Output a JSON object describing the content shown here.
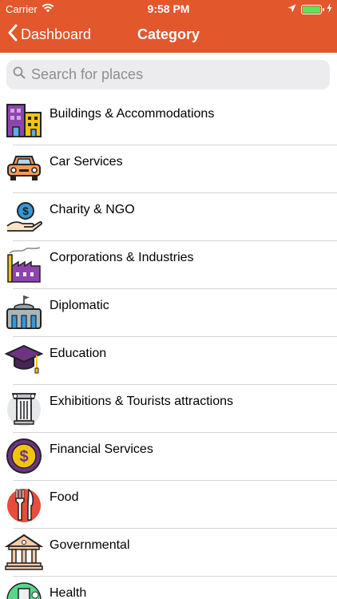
{
  "status_bar": {
    "carrier": "Carrier",
    "time": "9:58 PM",
    "battery_color": "#5ce35c"
  },
  "nav": {
    "back_label": "Dashboard",
    "title": "Category"
  },
  "search": {
    "placeholder": "Search for places",
    "value": ""
  },
  "colors": {
    "header": "#e2572c",
    "search_bg": "#ececee",
    "separator": "#d4d4d8"
  },
  "categories": [
    {
      "label": "Buildings & Accommodations",
      "icon": "buildings-icon"
    },
    {
      "label": "Car Services",
      "icon": "car-icon"
    },
    {
      "label": "Charity & NGO",
      "icon": "charity-hand-icon"
    },
    {
      "label": "Corporations & Industries",
      "icon": "factory-icon"
    },
    {
      "label": "Diplomatic",
      "icon": "embassy-icon"
    },
    {
      "label": "Education",
      "icon": "graduation-cap-icon"
    },
    {
      "label": "Exhibitions & Tourists attractions",
      "icon": "column-icon"
    },
    {
      "label": "Financial Services",
      "icon": "dollar-coin-icon"
    },
    {
      "label": "Food",
      "icon": "fork-knife-icon"
    },
    {
      "label": "Governmental",
      "icon": "government-building-icon"
    },
    {
      "label": "Health",
      "icon": "health-icon"
    }
  ]
}
